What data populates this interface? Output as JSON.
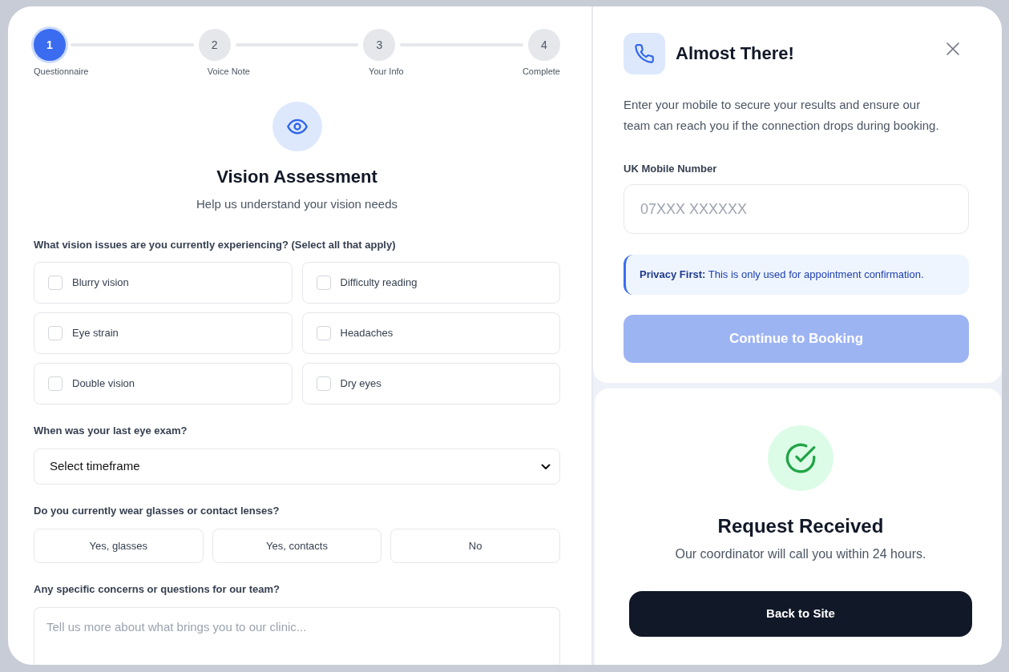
{
  "stepper": [
    {
      "number": "1",
      "label": "Questionnaire",
      "selected": true
    },
    {
      "number": "2",
      "label": "Voice Note",
      "selected": false
    },
    {
      "number": "3",
      "label": "Your Info",
      "selected": false
    },
    {
      "number": "4",
      "label": "Complete",
      "selected": false
    }
  ],
  "questionnaire": {
    "title": "Vision Assessment",
    "subtitle": "Help us understand your vision needs",
    "questions": [
      {
        "kind": "checkboxes",
        "label": "What vision issues are you currently experiencing? (Select all that apply)",
        "options": [
          {
            "label": "Blurry vision",
            "checked": false
          },
          {
            "label": "Difficulty reading",
            "checked": false
          },
          {
            "label": "Eye strain",
            "checked": false
          },
          {
            "label": "Headaches",
            "checked": false
          },
          {
            "label": "Double vision",
            "checked": false
          },
          {
            "label": "Dry eyes",
            "checked": false
          }
        ]
      },
      {
        "kind": "select",
        "label": "When was your last eye exam?",
        "value": "Select timeframe"
      },
      {
        "kind": "choice",
        "label": "Do you currently wear glasses or contact lenses?",
        "options": [
          {
            "label": "Yes, glasses",
            "selected": false
          },
          {
            "label": "Yes, contacts",
            "selected": false
          },
          {
            "label": "No",
            "selected": false
          }
        ]
      },
      {
        "kind": "textarea",
        "label": "Any specific concerns or questions for our team?",
        "placeholder": "Tell us more about what brings you to our clinic..."
      }
    ]
  },
  "phone_card": {
    "title": "Almost There!",
    "description": "Enter your mobile to secure your results and ensure our team can reach you if the connection drops during booking.",
    "field": {
      "label": "UK Mobile Number",
      "placeholder": "07XXX XXXXXX"
    },
    "notice": "**Privacy First:** This is only used for appointment confirmation.",
    "button": {
      "label": "Continue to Booking",
      "disabled": true
    }
  },
  "confirmation": {
    "title": "Request Received",
    "message": "Our coordinator will call you within 24 hours.",
    "button": "Back to Site"
  }
}
